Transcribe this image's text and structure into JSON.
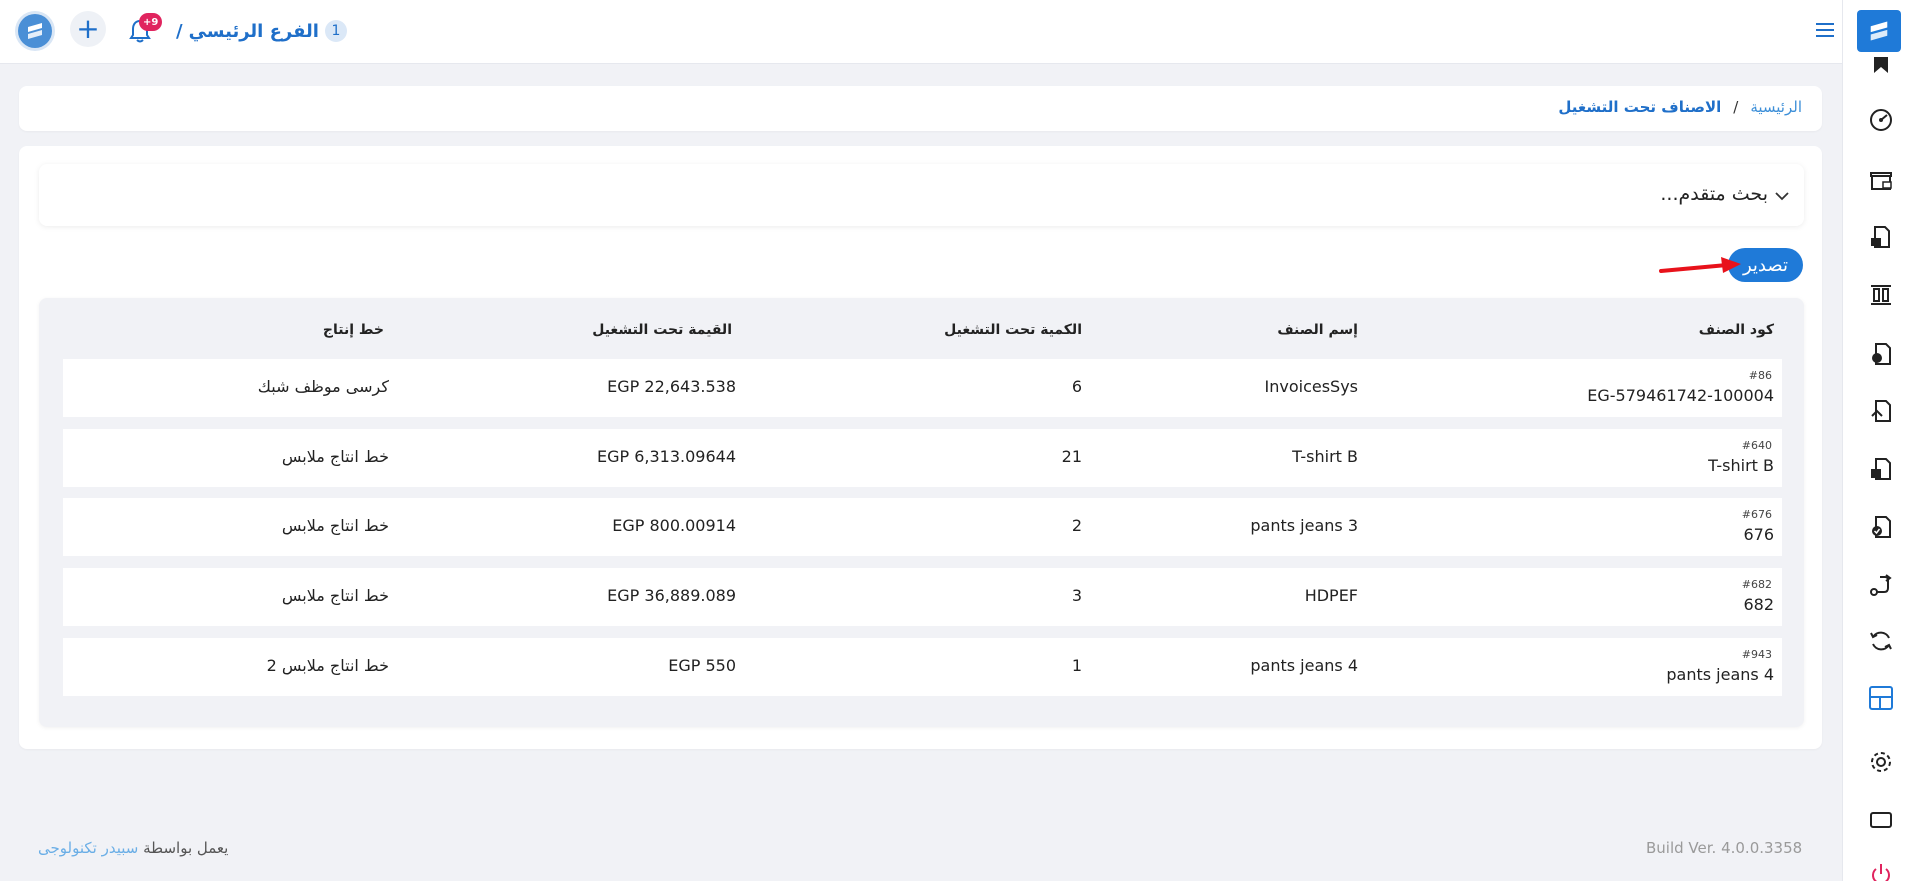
{
  "header": {
    "branch_number": "1",
    "branch_name": "الفرع الرئيسي",
    "branch_separator": "/",
    "notifications_badge": "+9",
    "add_label": "+"
  },
  "breadcrumb": {
    "home": "الرئيسية",
    "separator": "/",
    "current": "الاصناف تحت التشغيل"
  },
  "advanced_search": {
    "label": "بحث متقدم..."
  },
  "toolbar": {
    "export_label": "تصدير"
  },
  "table": {
    "headers": {
      "code": "كود الصنف",
      "name": "إسم الصنف",
      "quantity": "الكمية تحت التشغيل",
      "value": "القيمة تحت التشغيل",
      "line": "خط إنتاج"
    },
    "rows": [
      {
        "id": "#86",
        "code": "EG-579461742-100004",
        "name": "InvoicesSys",
        "quantity": "6",
        "value": "EGP 22,643.538",
        "line": "كرسى موظف شبك"
      },
      {
        "id": "#640",
        "code": "T-shirt B",
        "name": "T-shirt B",
        "quantity": "21",
        "value": "EGP 6,313.09644",
        "line": "خط انتاج ملابس"
      },
      {
        "id": "#676",
        "code": "676",
        "name": "pants jeans  3",
        "quantity": "2",
        "value": "EGP 800.00914",
        "line": "خط انتاج ملابس"
      },
      {
        "id": "#682",
        "code": "682",
        "name": "HDPEF",
        "quantity": "3",
        "value": "EGP 36,889.089",
        "line": "خط انتاج ملابس"
      },
      {
        "id": "#943",
        "code": "pants jeans  4",
        "name": "pants jeans  4",
        "quantity": "1",
        "value": "EGP 550",
        "line": "خط انتاج ملابس 2"
      }
    ]
  },
  "footer": {
    "powered_prefix": "يعمل بواسطة",
    "powered_brand": "سبيدر تكنولوجى",
    "build": "Build Ver. 4.0.0.3358"
  },
  "colors": {
    "accent": "#1f7ad8",
    "badge": "#e0245e",
    "annotation_arrow": "#e8121b"
  },
  "sidebar_icons": [
    "bookmark-icon",
    "speedometer-icon",
    "store-icon",
    "briefcase-document-icon",
    "columns-icon",
    "document-refresh-icon",
    "document-upload-icon",
    "document-box-icon",
    "document-check-icon",
    "route-icon",
    "sync-icon",
    "layout-icon",
    "gear-icon",
    "monitor-icon",
    "power-icon"
  ]
}
